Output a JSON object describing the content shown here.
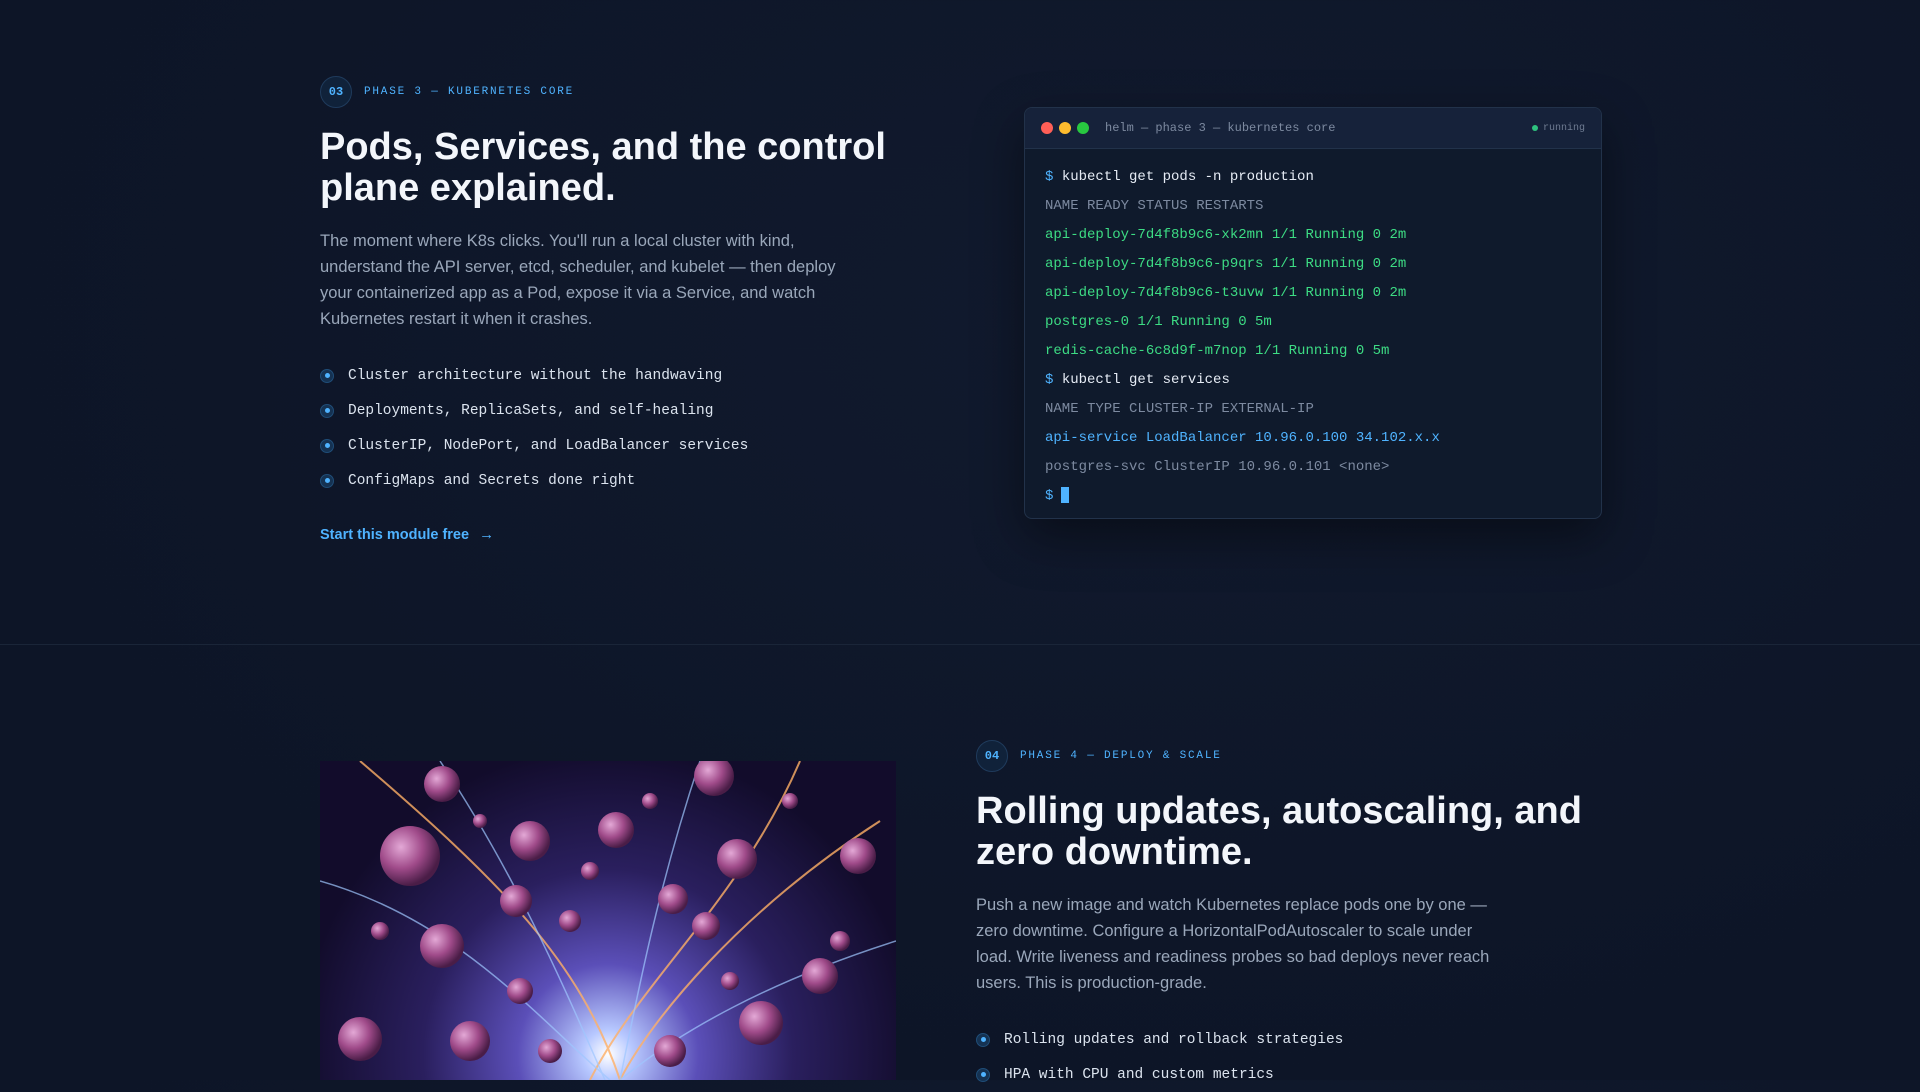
{
  "phase3": {
    "number": "03",
    "label": "PHASE 3 — KUBERNETES CORE",
    "title": "Pods, Services, and the control plane explained.",
    "description": "The moment where K8s clicks. You'll run a local cluster with kind, understand the API server, etcd, scheduler, and kubelet — then deploy your containerized app as a Pod, expose it via a Service, and watch Kubernetes restart it when it crashes.",
    "features": [
      "Cluster architecture without the handwaving",
      "Deployments, ReplicaSets, and self-healing",
      "ClusterIP, NodePort, and LoadBalancer services",
      "ConfigMaps and Secrets done right"
    ],
    "cta_label": "Start this module free",
    "cta_arrow": "→"
  },
  "terminal": {
    "title": "helm — phase 3 — kubernetes core",
    "status": "running",
    "prompt": "$",
    "lines": [
      {
        "type": "cmd",
        "text": "kubectl get pods -n production"
      },
      {
        "type": "header",
        "text": "NAME READY STATUS RESTARTS"
      },
      {
        "type": "ok",
        "text": "api-deploy-7d4f8b9c6-xk2mn 1/1 Running 0 2m"
      },
      {
        "type": "ok",
        "text": "api-deploy-7d4f8b9c6-p9qrs 1/1 Running 0 2m"
      },
      {
        "type": "ok",
        "text": "api-deploy-7d4f8b9c6-t3uvw 1/1 Running 0 2m"
      },
      {
        "type": "ok",
        "text": "postgres-0 1/1 Running 0 5m"
      },
      {
        "type": "ok",
        "text": "redis-cache-6c8d9f-m7nop 1/1 Running 0 5m"
      },
      {
        "type": "cmd",
        "text": "kubectl get services"
      },
      {
        "type": "header",
        "text": "NAME TYPE CLUSTER-IP EXTERNAL-IP"
      },
      {
        "type": "info",
        "text": "api-service LoadBalancer 10.96.0.100 34.102.x.x"
      },
      {
        "type": "muted",
        "text": "postgres-svc ClusterIP 10.96.0.101 <none>"
      }
    ]
  },
  "phase4": {
    "number": "04",
    "label": "PHASE 4 — DEPLOY & SCALE",
    "title": "Rolling updates, autoscaling, and zero downtime.",
    "description": "Push a new image and watch Kubernetes replace pods one by one — zero downtime. Configure a HorizontalPodAutoscaler to scale under load. Write liveness and readiness probes so bad deploys never reach users. This is production-grade.",
    "features": [
      "Rolling updates and rollback strategies",
      "HPA with CPU and custom metrics"
    ]
  },
  "colors": {
    "background": "#0d1527",
    "accent": "#4fb3ff",
    "ok": "#3ddc84",
    "muted": "#7d8aa0"
  }
}
